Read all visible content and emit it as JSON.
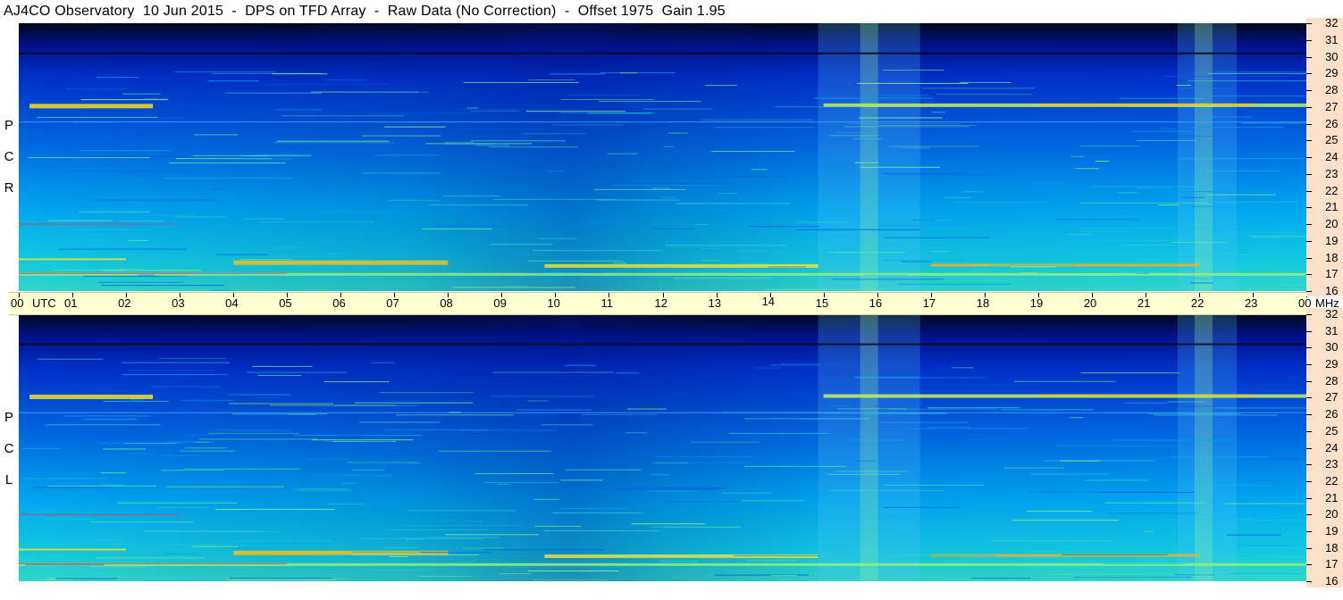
{
  "header": {
    "title": "AJ4CO Observatory  10 Jun 2015  -  DPS on TFD Array  -  Raw Data (No Correction)  -  Offset 1975  Gain 1.95"
  },
  "panels": [
    {
      "id": "rcp",
      "letters": [
        "R",
        "C",
        "P"
      ]
    },
    {
      "id": "lcp",
      "letters": [
        "L",
        "C",
        "P"
      ]
    }
  ],
  "chart_data": {
    "type": "heatmap",
    "title": "AJ4CO Observatory  10 Jun 2015  -  DPS on TFD Array  -  Raw Data (No Correction)  -  Offset 1975  Gain 1.95",
    "x_axis": {
      "label": "UTC",
      "ticks": [
        "00",
        "01",
        "02",
        "03",
        "04",
        "05",
        "06",
        "07",
        "08",
        "09",
        "10",
        "11",
        "12",
        "13",
        "14",
        "15",
        "16",
        "17",
        "18",
        "19",
        "20",
        "21",
        "22",
        "23",
        "00"
      ],
      "range": [
        0,
        24
      ]
    },
    "y_axis": {
      "label": "MHz",
      "ticks": [
        32,
        31,
        30,
        29,
        28,
        27,
        26,
        25,
        24,
        23,
        22,
        21,
        20,
        19,
        18,
        17,
        16
      ],
      "range": [
        16,
        32
      ]
    },
    "series": [
      {
        "name": "R C P"
      },
      {
        "name": "L C P"
      }
    ],
    "colormap": [
      "#000010",
      "#00106a",
      "#0030c0",
      "#0070e8",
      "#00b0f0",
      "#20d8d0",
      "#90f080",
      "#ffff00",
      "#ff8000",
      "#ff0000"
    ],
    "bright_bursts_utc": [
      [
        14.9,
        16.8
      ],
      [
        21.6,
        22.7
      ]
    ]
  }
}
